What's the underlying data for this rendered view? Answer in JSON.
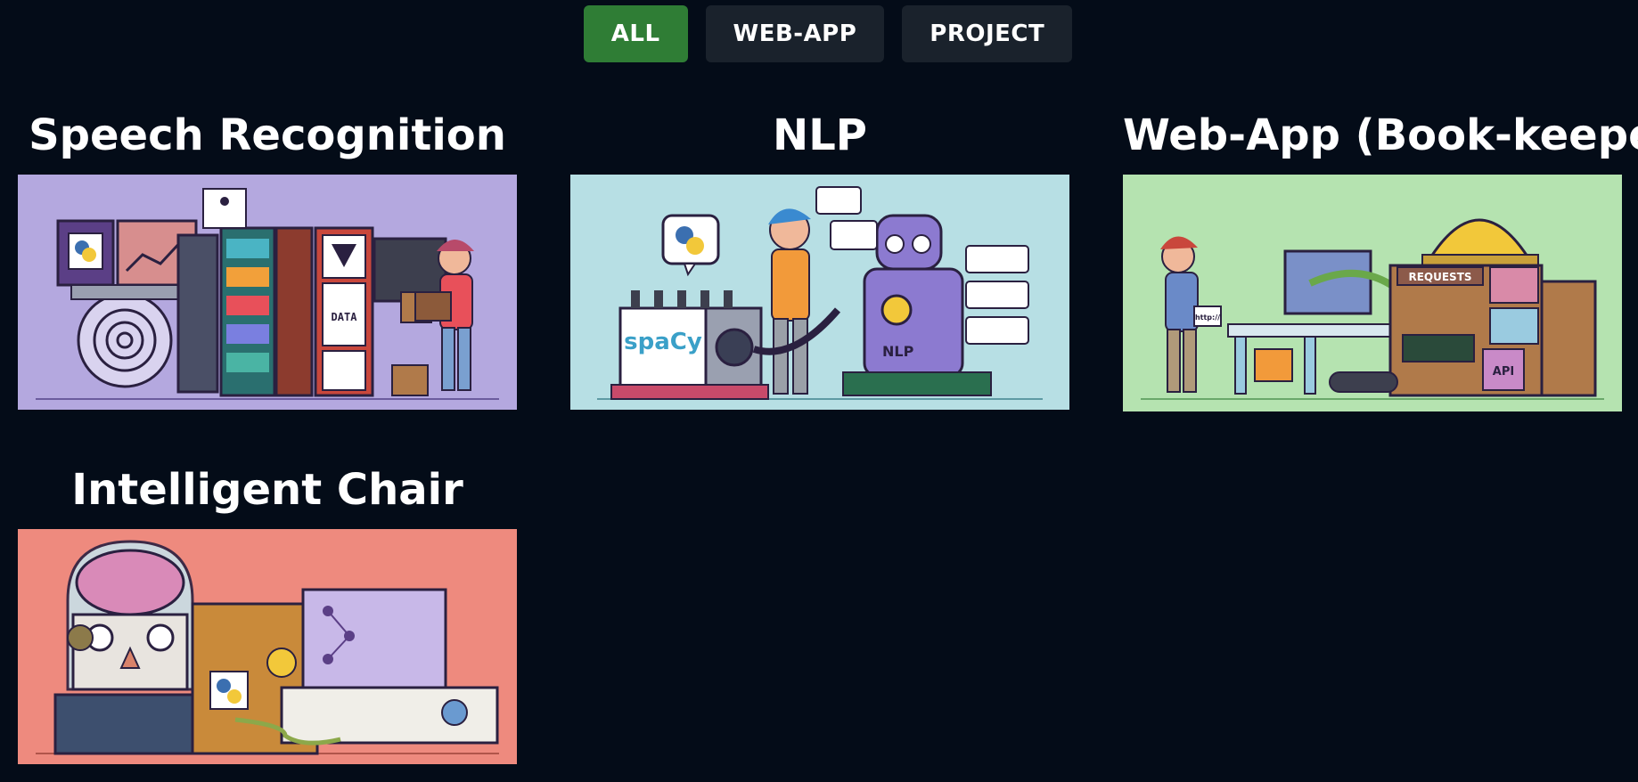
{
  "filters": {
    "all": "ALL",
    "web_app": "WEB-APP",
    "project": "PROJECT",
    "active": "all"
  },
  "projects": [
    {
      "title": "Speech Recognition",
      "image_bg": "#b4a8df",
      "image_labels": {
        "data": "DATA"
      }
    },
    {
      "title": "NLP",
      "image_bg": "#b7dfe4",
      "image_labels": {
        "lib": "spaCy",
        "robot": "NLP"
      }
    },
    {
      "title": "Web-App (Book-keeper)",
      "image_bg": "#b5e3b0",
      "image_labels": {
        "requests": "REQUESTS",
        "api": "API",
        "http": "http://"
      }
    },
    {
      "title": "Intelligent Chair",
      "image_bg": "#ee8a7e",
      "image_labels": {}
    }
  ],
  "colors": {
    "page_bg": "#040c18",
    "button_bg": "#1a222c",
    "button_active_bg": "#2f7d35"
  }
}
